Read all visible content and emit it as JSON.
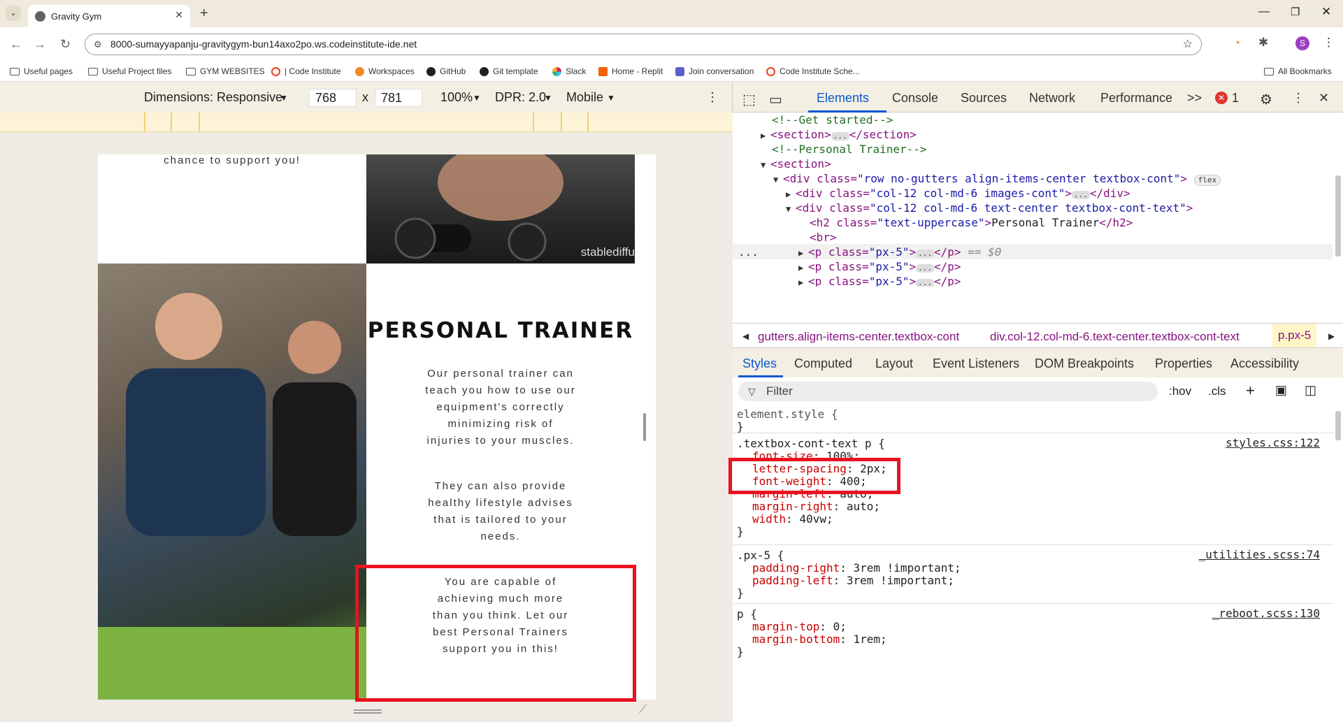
{
  "browser": {
    "tab_title": "Gravity Gym",
    "url": "8000-sumayyapanju-gravitygym-bun14axo2po.ws.codeinstitute-ide.net",
    "profile_initial": "S",
    "bookmarks": [
      "Useful pages",
      "Useful Project files",
      "GYM WEBSITES",
      "| Code Institute",
      "Workspaces",
      "GitHub",
      "Git template",
      "Slack",
      "Home - Replit",
      "Join conversation",
      "Code Institute Sche..."
    ],
    "all_bookmarks": "All Bookmarks"
  },
  "device_toolbar": {
    "dimensions": "Dimensions: Responsive",
    "width": "768",
    "times": "x",
    "height": "781",
    "zoom": "100%",
    "dpr": "DPR: 2.0",
    "mode": "Mobile"
  },
  "page": {
    "top_text": "chance to support you!",
    "watermark": "stablediffu",
    "heading": "PERSONAL TRAINER",
    "p1": "Our personal trainer can teach you how to use our equipment's correctly minimizing risk of injuries to your muscles.",
    "p2": "They can also provide healthy lifestyle advises that is tailored to your needs.",
    "p3": "You are capable of achieving much more than you think. Let our best Personal Trainers support you in this!"
  },
  "devtools": {
    "tabs": [
      "Elements",
      "Console",
      "Sources",
      "Network",
      "Performance"
    ],
    "more": ">>",
    "error_count": "1",
    "dom": {
      "l1": "<!--Get started-->",
      "l2a": "<section>",
      "l2b": "</section>",
      "l3": "<!--Personal Trainer-->",
      "l4": "<section>",
      "l5a": "<div class=",
      "l5b": "\"row no-gutters align-items-center textbox-cont\"",
      "l5c": ">",
      "flex": "flex",
      "l6a": "<div class=",
      "l6b": "\"col-12 col-md-6 images-cont\"",
      "l6c": ">",
      "l6d": "</div>",
      "l7a": "<div class=",
      "l7b": "\"col-12 col-md-6 text-center textbox-cont-text\"",
      "l7c": ">",
      "l8a": "<h2 class=",
      "l8b": "\"text-uppercase\"",
      "l8c": ">",
      "l8d": "Personal Trainer",
      "l8e": "</h2>",
      "l9": "<br>",
      "pa": "<p class=",
      "pb": "\"px-5\"",
      "pc": ">",
      "pd": "</p>",
      "selected_marker": "== $0",
      "ellipsis": "..."
    },
    "breadcrumbs": [
      "gutters.align-items-center.textbox-cont",
      "div.col-12.col-md-6.text-center.textbox-cont-text",
      "p.px-5"
    ],
    "subtabs": [
      "Styles",
      "Computed",
      "Layout",
      "Event Listeners",
      "DOM Breakpoints",
      "Properties",
      "Accessibility"
    ],
    "filter": "Filter",
    "hov": ":hov",
    "cls": ".cls",
    "styles": {
      "r0_sel": "element.style {",
      "close": "}",
      "r1_sel": ".textbox-cont-text p {",
      "r1_src": "styles.css:122",
      "r1_props": [
        [
          "font-size",
          "100%;"
        ],
        [
          "letter-spacing",
          "2px;"
        ],
        [
          "font-weight",
          "400;"
        ],
        [
          "margin-left",
          "auto;"
        ],
        [
          "margin-right",
          "auto;"
        ],
        [
          "width",
          "40vw;"
        ]
      ],
      "r2_sel": ".px-5 {",
      "r2_src": "_utilities.scss:74",
      "r2_props": [
        [
          "padding-right",
          "3rem !important;"
        ],
        [
          "padding-left",
          "3rem !important;"
        ]
      ],
      "r3_sel": "p {",
      "r3_src": "_reboot.scss:130",
      "r3_props": [
        [
          "margin-top",
          "0;"
        ],
        [
          "margin-bottom",
          "1rem;"
        ]
      ]
    }
  },
  "colors": {
    "highlight": "#e8131f",
    "devtools_accent": "#0b57d0"
  }
}
